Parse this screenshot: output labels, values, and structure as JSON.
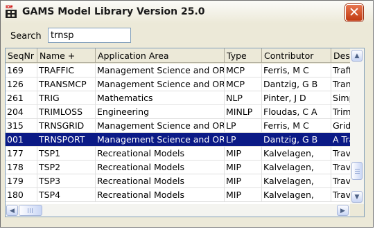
{
  "window": {
    "title": "GAMS Model Library Version 25.0",
    "icon_label": "IDE"
  },
  "search": {
    "label": "Search",
    "value": "trnsp"
  },
  "table": {
    "columns": [
      "SeqNr",
      "Name +",
      "Application Area",
      "Type",
      "Contributor",
      "Description"
    ],
    "rows": [
      [
        "169",
        "TRAFFIC",
        "Management Science and OR",
        "MCP",
        "Ferris, M C",
        "Traffic"
      ],
      [
        "126",
        "TRANSMCP",
        "Management Science and OR",
        "MCP",
        "Dantzig, G B",
        "Transport"
      ],
      [
        "261",
        "TRIG",
        "Mathematics",
        "NLP",
        "Pinter, J D",
        "Simple"
      ],
      [
        "204",
        "TRIMLOSS",
        "Engineering",
        "MINLP",
        "Floudas, C A",
        "Trim"
      ],
      [
        "315",
        "TRNSGRID",
        "Management Science and OR",
        "LP",
        "Ferris, M C",
        "Grid"
      ],
      [
        "001",
        "TRNSPORT",
        "Management Science and OR",
        "LP",
        "Dantzig, G B",
        "A Transport"
      ],
      [
        "177",
        "TSP1",
        "Recreational Models",
        "MIP",
        "Kalvelagen,",
        "Travel"
      ],
      [
        "178",
        "TSP2",
        "Recreational Models",
        "MIP",
        "Kalvelagen,",
        "Travel"
      ],
      [
        "179",
        "TSP3",
        "Recreational Models",
        "MIP",
        "Kalvelagen,",
        "Travel"
      ],
      [
        "180",
        "TSP4",
        "Recreational Models",
        "MIP",
        "Kalvelagen,",
        "Travel"
      ]
    ],
    "selected_row": "001"
  },
  "colors": {
    "selection": "#0b1a86",
    "close_button": "#c13a12"
  },
  "icons": {
    "close": "close-icon",
    "scroll_up": "arrow-up-icon",
    "scroll_down": "arrow-down-icon",
    "scroll_left": "arrow-left-icon",
    "scroll_right": "arrow-right-icon"
  }
}
